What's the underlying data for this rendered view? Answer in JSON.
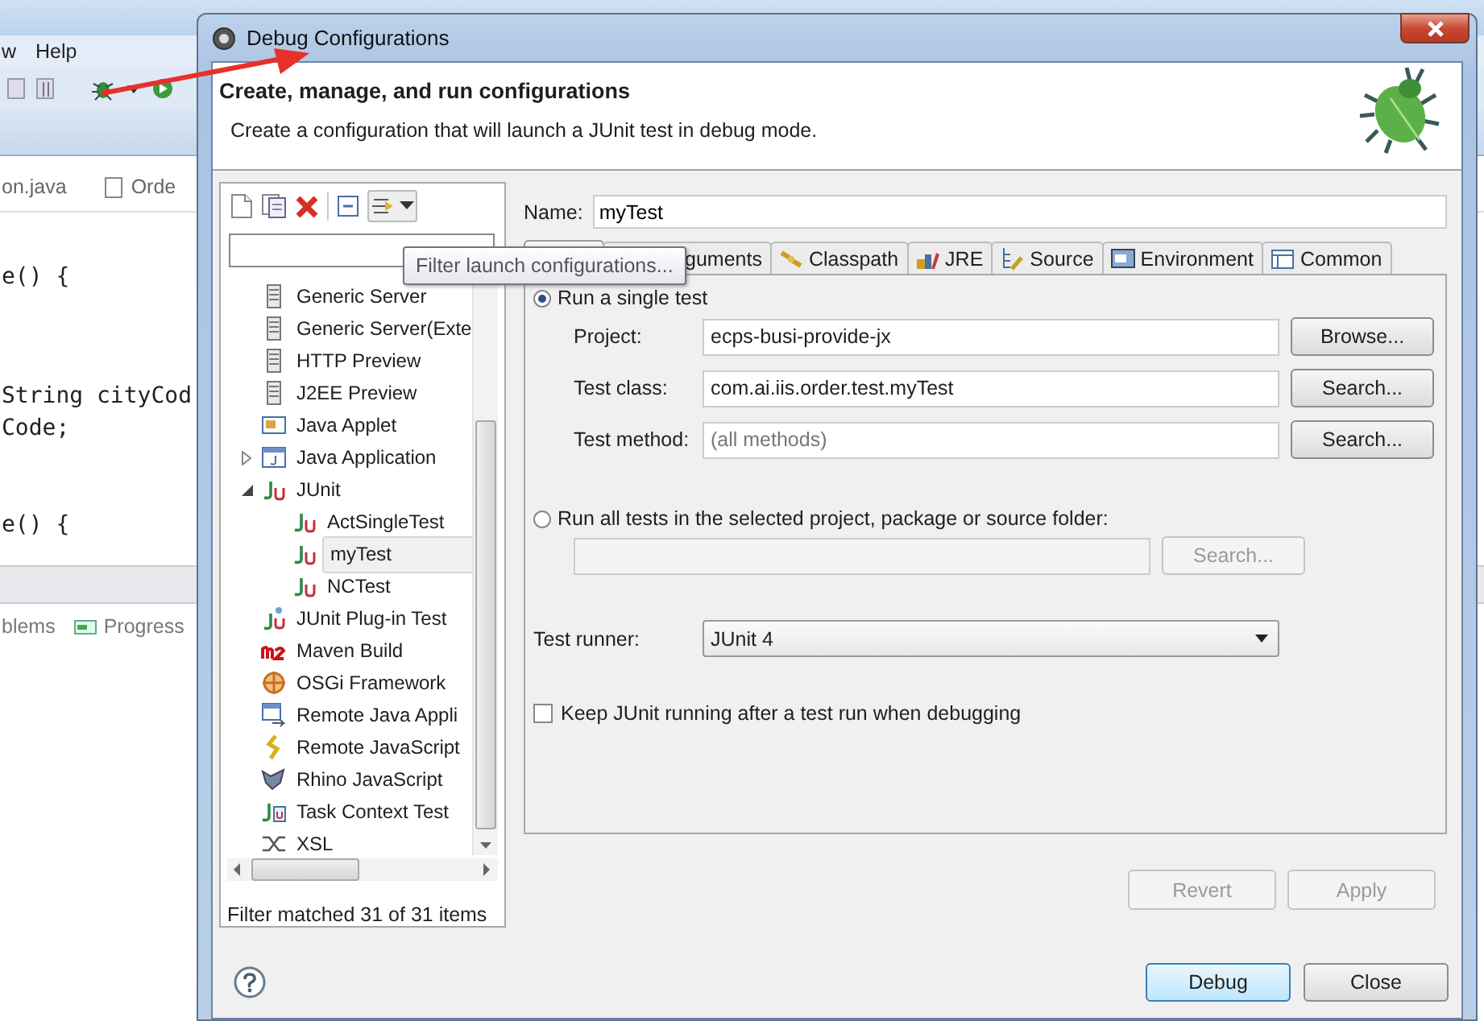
{
  "ide": {
    "menu": [
      "w",
      "Help"
    ],
    "editor_tabs": [
      "on.java",
      "Orde"
    ],
    "code_lines": [
      "e() {",
      "String cityCod",
      "Code;",
      "e() {"
    ],
    "panel_tabs": [
      "blems",
      "Progress"
    ]
  },
  "dialog": {
    "title": "Debug Configurations",
    "header": {
      "title": "Create, manage, and run configurations",
      "message": "Create a configuration that will launch a JUnit test in debug mode."
    },
    "tooltip": "Filter launch configurations...",
    "tree": [
      {
        "label": "Generic Server",
        "kind": "server",
        "selected": false
      },
      {
        "label": "Generic Server(Exte",
        "kind": "server",
        "selected": false
      },
      {
        "label": "HTTP Preview",
        "kind": "server",
        "selected": false
      },
      {
        "label": "J2EE Preview",
        "kind": "server",
        "selected": false
      },
      {
        "label": "Java Applet",
        "kind": "applet",
        "selected": false
      },
      {
        "label": "Java Application",
        "kind": "application",
        "selected": false,
        "expanded": false
      },
      {
        "label": "JUnit",
        "kind": "junit",
        "selected": false,
        "expanded": true,
        "children": [
          {
            "label": "ActSingleTest",
            "kind": "junit",
            "selected": false
          },
          {
            "label": "myTest",
            "kind": "junit",
            "selected": true
          },
          {
            "label": "NCTest",
            "kind": "junit",
            "selected": false
          }
        ]
      },
      {
        "label": "JUnit Plug-in Test",
        "kind": "plugin",
        "selected": false
      },
      {
        "label": "Maven Build",
        "kind": "maven",
        "selected": false
      },
      {
        "label": "OSGi Framework",
        "kind": "osgi",
        "selected": false
      },
      {
        "label": "Remote Java Appli",
        "kind": "remote",
        "selected": false
      },
      {
        "label": "Remote JavaScript",
        "kind": "script",
        "selected": false
      },
      {
        "label": "Rhino JavaScript",
        "kind": "rhino",
        "selected": false
      },
      {
        "label": "Task Context Test",
        "kind": "task",
        "selected": false
      },
      {
        "label": "XSL",
        "kind": "xsl",
        "selected": false
      }
    ],
    "filter_status": "Filter matched 31 of 31 items",
    "name": {
      "label": "Name:",
      "value": "myTest"
    },
    "tabs": [
      {
        "kind": "test",
        "selected": true
      },
      {
        "label": "guments",
        "kind": "arguments",
        "selected": false
      },
      {
        "label": "Classpath",
        "kind": "classpath",
        "selected": false
      },
      {
        "label": "JRE",
        "kind": "jre",
        "selected": false
      },
      {
        "label": "Source",
        "kind": "source",
        "selected": false
      },
      {
        "label": "Environment",
        "kind": "environment",
        "selected": false
      },
      {
        "label": "Common",
        "kind": "common",
        "selected": false
      }
    ],
    "single_test": {
      "label": "Run a single test",
      "selected": true,
      "fields": [
        {
          "label": "Project:",
          "value": "ecps-busi-provide-jx",
          "button": "Browse..."
        },
        {
          "label": "Test class:",
          "value": "com.ai.iis.order.test.myTest",
          "button": "Search..."
        },
        {
          "label": "Test method:",
          "placeholder": "(all methods)",
          "button": "Search..."
        }
      ]
    },
    "all_tests": {
      "label": "Run all tests in the selected project, package or source folder:",
      "selected": false,
      "disabled": true,
      "button": "Search..."
    },
    "test_runner": {
      "label": "Test runner:",
      "value": "JUnit 4"
    },
    "keep_running": {
      "label": "Keep JUnit running after a test run when debugging",
      "checked": false
    },
    "panel_buttons": [
      {
        "label": "Revert",
        "disabled": true
      },
      {
        "label": "Apply",
        "disabled": true
      }
    ],
    "buttons": [
      {
        "label": "Debug",
        "default": true
      },
      {
        "label": "Close",
        "default": false
      }
    ]
  }
}
